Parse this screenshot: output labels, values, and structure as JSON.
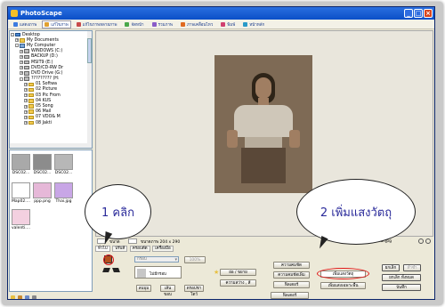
{
  "window": {
    "title": "PhotoScape",
    "controls": {
      "min": "_",
      "max": "□",
      "close": "×"
    }
  },
  "menubar": {
    "tabs": [
      {
        "label": "แสดงภาพ",
        "color": "#3b7be0"
      },
      {
        "label": "แก้ไขภาพ",
        "color": "#e0a030",
        "active": true
      },
      {
        "label": "แก้ไขภาพหลายภาพ",
        "color": "#c84b4b"
      },
      {
        "label": "จัดหน้า",
        "color": "#4aa84a"
      },
      {
        "label": "รวมภาพ",
        "color": "#8a5cc8"
      },
      {
        "label": "ภาพเคลื่อนไหว",
        "color": "#e06a20"
      },
      {
        "label": "พิมพ์",
        "color": "#d04070"
      },
      {
        "label": "หน้าหลัก",
        "color": "#2a9ac8"
      }
    ]
  },
  "tree": {
    "items": [
      {
        "label": "Desktop",
        "level": 0,
        "icon": "desktop-icon",
        "toggle": "-"
      },
      {
        "label": "My Documents",
        "level": 1,
        "icon": "folder-icon",
        "toggle": "+"
      },
      {
        "label": "My Computer",
        "level": 1,
        "icon": "computer-icon",
        "toggle": "-"
      },
      {
        "label": "WINDOWS (C:)",
        "level": 2,
        "icon": "drive-icon",
        "toggle": "+"
      },
      {
        "label": "BACKUP (D:)",
        "level": 2,
        "icon": "drive-icon",
        "toggle": "+"
      },
      {
        "label": "MSIT9 (E:)",
        "level": 2,
        "icon": "drive-icon",
        "toggle": "+"
      },
      {
        "label": "DVD/CD-RW Dr",
        "level": 2,
        "icon": "drive-icon",
        "toggle": "+"
      },
      {
        "label": "DVD Drive (G:)",
        "level": 2,
        "icon": "drive-icon",
        "toggle": "+"
      },
      {
        "label": "????????? (H:",
        "level": 2,
        "icon": "drive-icon",
        "toggle": "-"
      },
      {
        "label": "01 Softwa",
        "level": 3,
        "icon": "folder-icon",
        "toggle": "+"
      },
      {
        "label": "02 Picture",
        "level": 3,
        "icon": "folder-icon",
        "toggle": "+"
      },
      {
        "label": "03 Pic From",
        "level": 3,
        "icon": "folder-icon",
        "toggle": "+"
      },
      {
        "label": "04 KUS",
        "level": 3,
        "icon": "folder-icon",
        "toggle": "+"
      },
      {
        "label": "05 Song",
        "level": 3,
        "icon": "folder-icon",
        "toggle": "+"
      },
      {
        "label": "06 Mail",
        "level": 3,
        "icon": "folder-icon",
        "toggle": "+"
      },
      {
        "label": "07 VDO& M",
        "level": 3,
        "icon": "folder-icon",
        "toggle": "+"
      },
      {
        "label": "08 Jakti",
        "level": 3,
        "icon": "folder-icon",
        "toggle": "+"
      }
    ]
  },
  "thumbnails": [
    {
      "label": "DSC02...",
      "color": "#a9a9a9"
    },
    {
      "label": "DSC02...",
      "color": "#8c8c8c"
    },
    {
      "label": "DSC02...",
      "color": "#b7b7b7"
    },
    {
      "label": "Map02....",
      "color": "#ffffff"
    },
    {
      "label": "ppp.png",
      "color": "#e6b8d8"
    },
    {
      "label": "Thai.jpg",
      "color": "#c8a6e6"
    },
    {
      "label": "valenti....",
      "color": "#f3d0e0"
    }
  ],
  "canvas_status": {
    "left_btn": "ขนาด",
    "size": "ขนาดภาพ 204 x 290",
    "filename": "Thai.jpg"
  },
  "panel": {
    "tabs": [
      "ทั่วไป",
      "ปรับสี",
      "ครอบตัด",
      "เครื่องมือ"
    ],
    "frame_select": "กรอบ",
    "frame_name": "ไม่มีกรอบ",
    "frame_percent": "100%",
    "round_buttons": [
      "ลบมุม",
      "เส้นขอบ",
      "ดรอปชาโดว์"
    ],
    "dropdowns_col1": [
      "ย่อ / ขยาย",
      "ความสว่าง , สี"
    ],
    "dropdowns_col2": [
      "ความคมชัด",
      "ความคมชัดเพิ่ม",
      "ฟิลเตอร์"
    ],
    "dropdowns_col3": [
      "ความเข้ม",
      "ความคมชัดทั่ว",
      "ฟิลเตอร์"
    ],
    "backlight": "เพิ่มแสงวัตถุ",
    "auto_contrast": "เพิ่มแสงเฉพาะพื้น",
    "side_buttons": [
      "ยกเลิก",
      "ทำซ้ำ",
      "ยกเลิก ทั้งหมด",
      "บันทึก"
    ]
  },
  "annotations": {
    "bubble1": "1 คลิก",
    "bubble2": "2 เพิ่มแสงวัตถุ"
  },
  "photo": {
    "colors": {
      "bg": "#7e6a55",
      "dress": "#cfc7b9",
      "skin": "#a07e62",
      "hair": "#2e2418",
      "skirt": "#5a4838"
    }
  }
}
